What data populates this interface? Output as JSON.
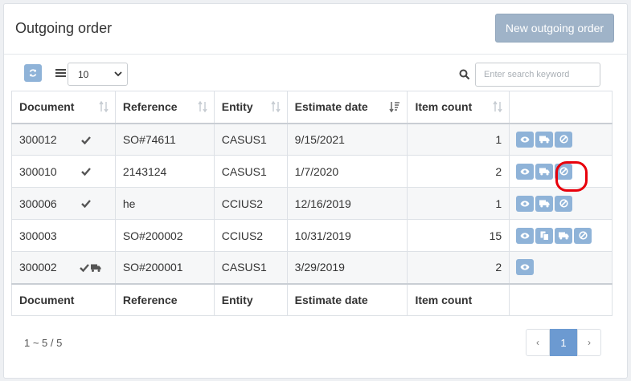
{
  "header": {
    "title": "Outgoing order",
    "new_button": "New outgoing order"
  },
  "toolbar": {
    "page_size": "10",
    "search_placeholder": "Enter search keyword"
  },
  "columns": [
    "Document",
    "Reference",
    "Entity",
    "Estimate date",
    "Item count"
  ],
  "rows": [
    {
      "document": "300012",
      "reference": "SO#74611",
      "entity": "CASUS1",
      "estimate_date": "9/15/2021",
      "item_count": "1"
    },
    {
      "document": "300010",
      "reference": "2143124",
      "entity": "CASUS1",
      "estimate_date": "1/7/2020",
      "item_count": "2"
    },
    {
      "document": "300006",
      "reference": "he",
      "entity": "CCIUS2",
      "estimate_date": "12/16/2019",
      "item_count": "1"
    },
    {
      "document": "300003",
      "reference": "SO#200002",
      "entity": "CCIUS2",
      "estimate_date": "10/31/2019",
      "item_count": "15"
    },
    {
      "document": "300002",
      "reference": "SO#200001",
      "entity": "CASUS1",
      "estimate_date": "3/29/2019",
      "item_count": "2"
    }
  ],
  "footer": {
    "info": "1 ~ 5 / 5",
    "current_page": "1",
    "prev": "‹",
    "next": "›"
  },
  "colors": {
    "accent": "#8fb3d8",
    "highlight": "#e8000b"
  }
}
